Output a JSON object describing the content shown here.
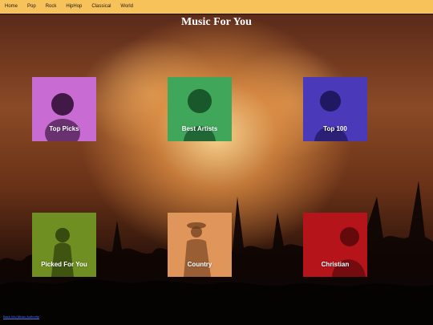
{
  "nav": {
    "items": [
      "Home",
      "Pop",
      "Rock",
      "HipHop",
      "Classical",
      "World"
    ]
  },
  "page_title": "Music For You",
  "tiles": [
    {
      "label": "Top Picks",
      "color": "#c86bd2"
    },
    {
      "label": "Best Artists",
      "color": "#3fa65a"
    },
    {
      "label": "Top 100",
      "color": "#4a39b8"
    },
    {
      "label": "Picked For You",
      "color": "#6f8f22"
    },
    {
      "label": "Country",
      "color": "#e0955a"
    },
    {
      "label": "Christian",
      "color": "#b5151a"
    }
  ],
  "footer": {
    "link_text": "Back Into Music Authority"
  }
}
